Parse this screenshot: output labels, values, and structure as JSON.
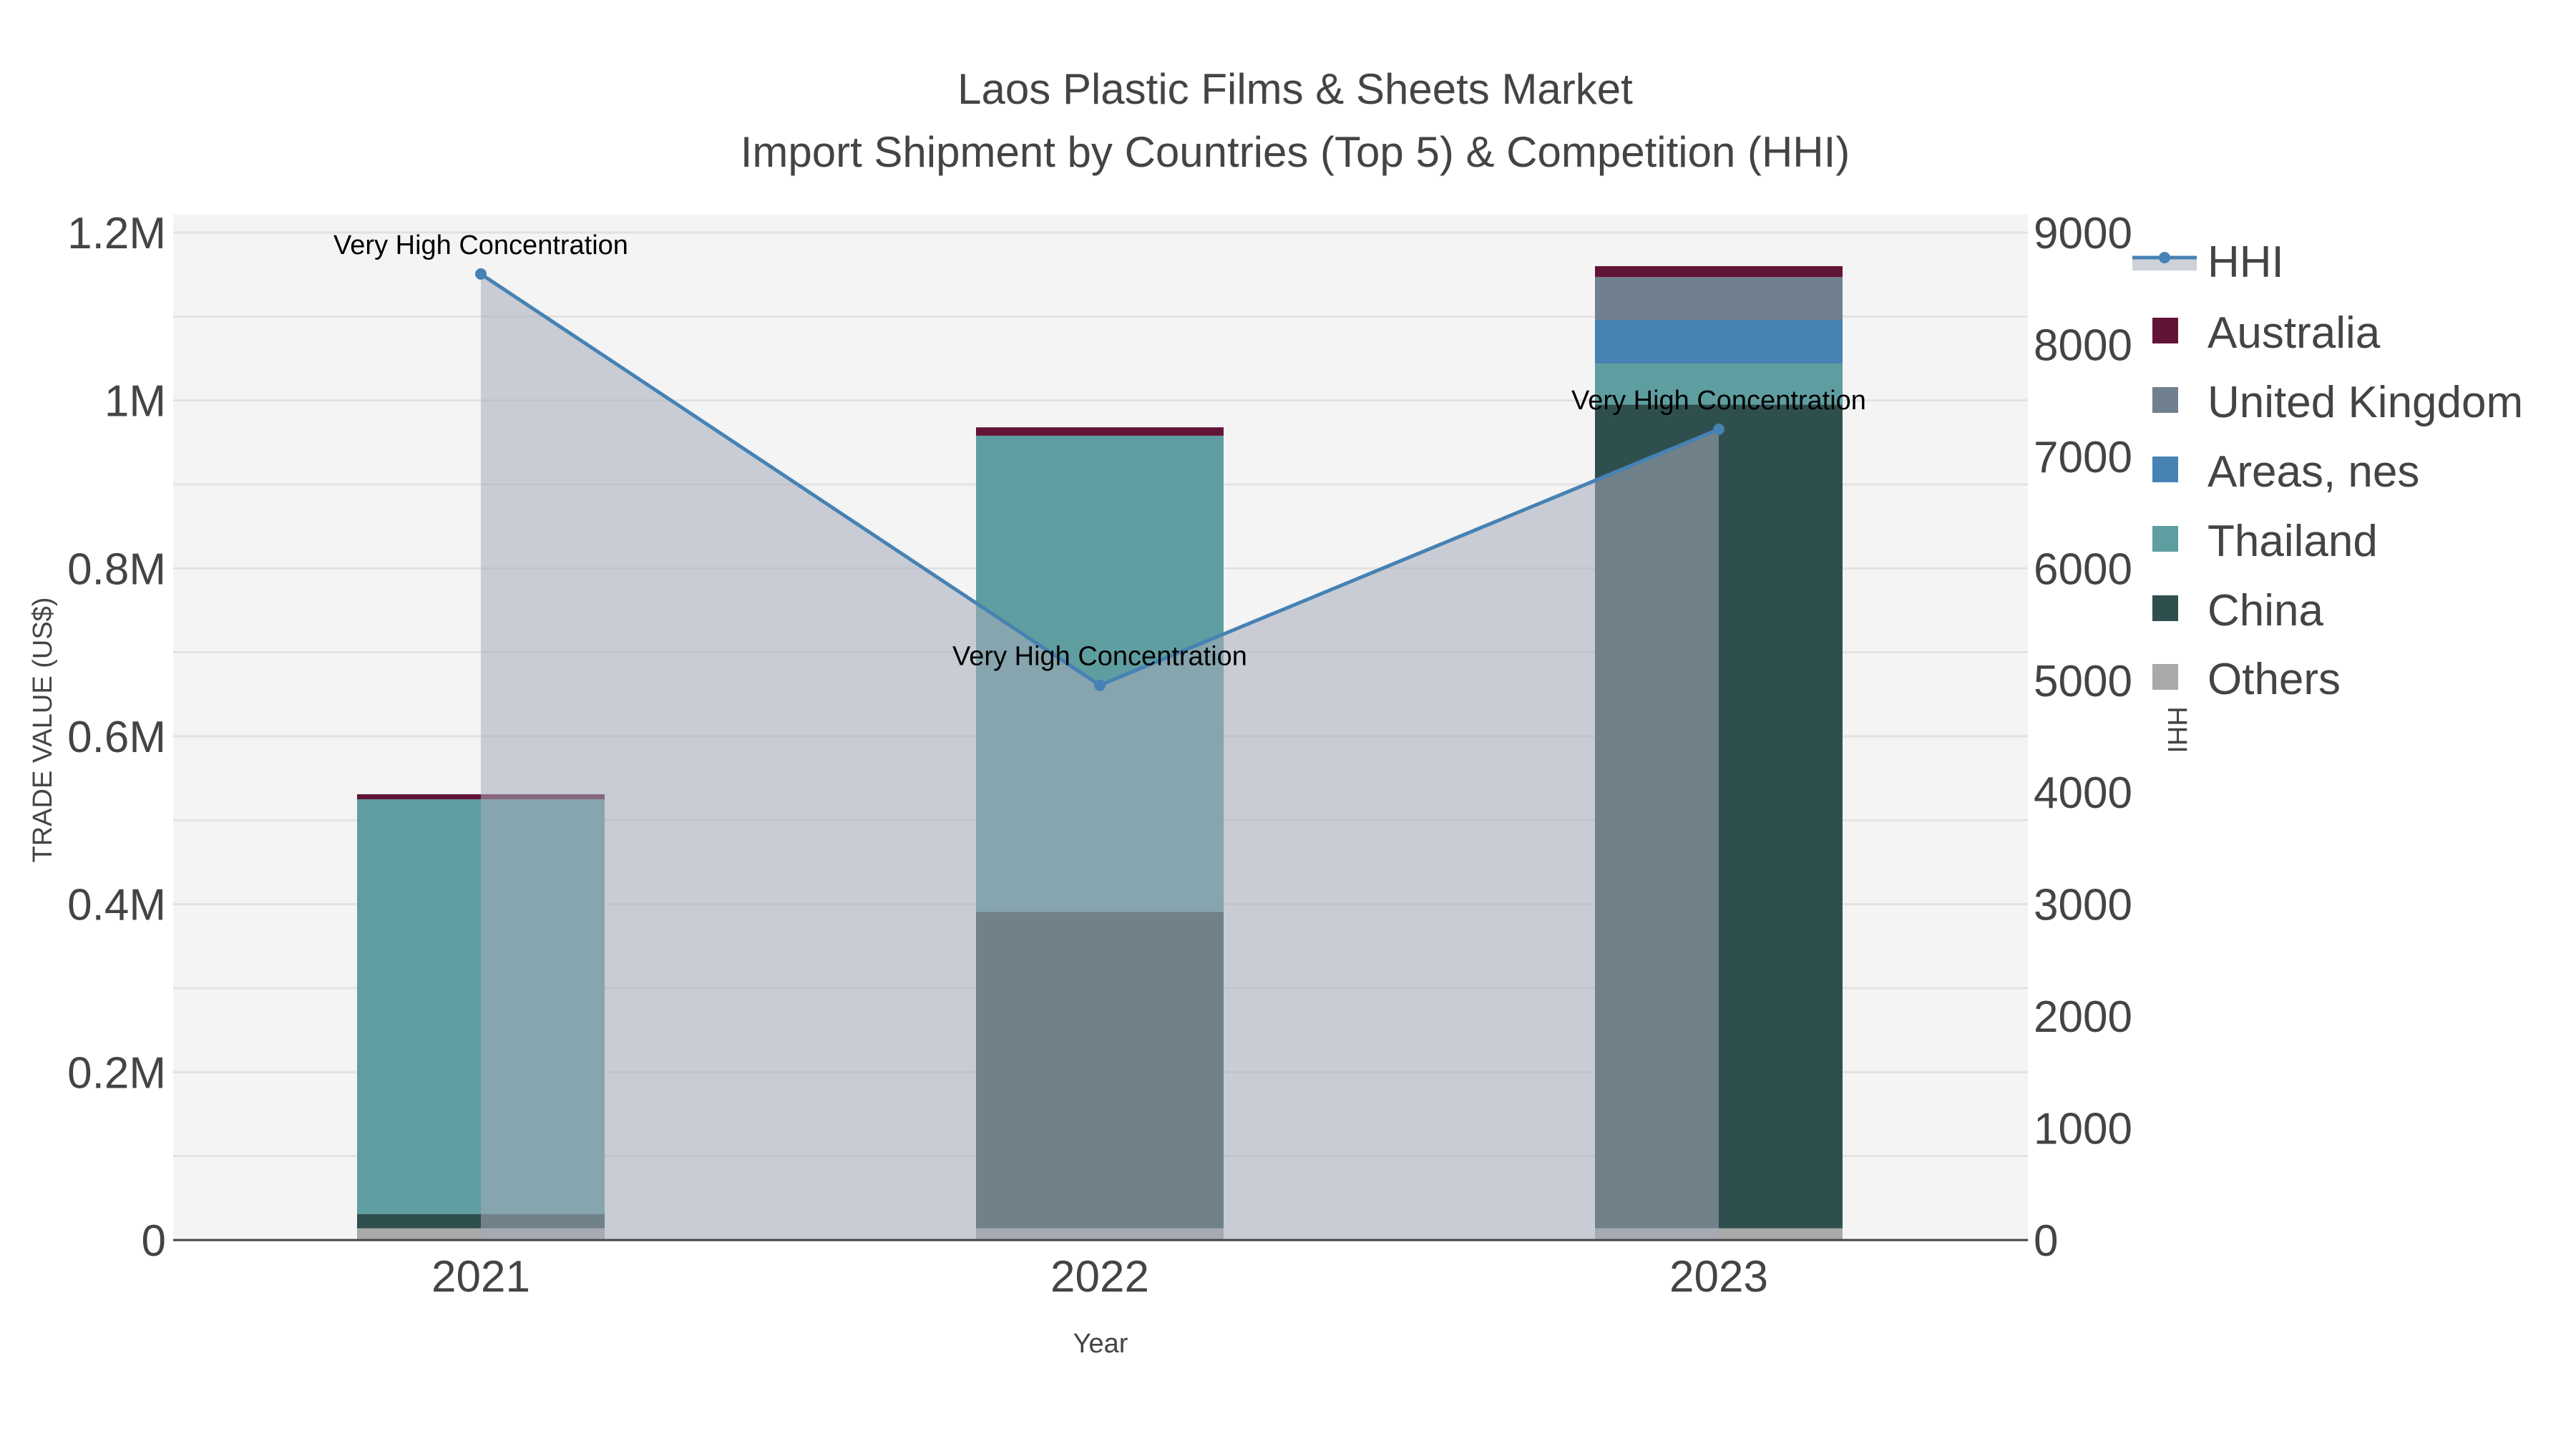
{
  "chart_data": {
    "type": "bar",
    "barmode": "stack",
    "title": "Laos Plastic Films & Sheets Market",
    "subtitle": "Import Shipment by Countries (Top 5) & Competition (HHI)",
    "xlabel": "Year",
    "ylabel": "TRADE VALUE (US$)",
    "y2label": "HHI",
    "categories": [
      "2021",
      "2022",
      "2023"
    ],
    "ylim": [
      0,
      1200000
    ],
    "y2lim": [
      0,
      9000
    ],
    "yticks": [
      {
        "v": 0,
        "label": "0"
      },
      {
        "v": 200000,
        "label": "0.2M"
      },
      {
        "v": 400000,
        "label": "0.4M"
      },
      {
        "v": 600000,
        "label": "0.6M"
      },
      {
        "v": 800000,
        "label": "0.8M"
      },
      {
        "v": 1000000,
        "label": "1M"
      },
      {
        "v": 1200000,
        "label": "1.2M"
      }
    ],
    "y2ticks": [
      "0",
      "1000",
      "2000",
      "3000",
      "4000",
      "5000",
      "6000",
      "7000",
      "8000",
      "9000"
    ],
    "series": [
      {
        "name": "Others",
        "color": "#a9a9a9",
        "values": [
          14000,
          14000,
          14000
        ]
      },
      {
        "name": "China",
        "color": "#2f4f4f",
        "values": [
          17000,
          377000,
          981000
        ]
      },
      {
        "name": "Thailand",
        "color": "#5f9ea0",
        "values": [
          494000,
          567000,
          49000
        ]
      },
      {
        "name": "Areas, nes",
        "color": "#4682b4",
        "values": [
          0,
          0,
          52000
        ]
      },
      {
        "name": "United Kingdom",
        "color": "#708090",
        "values": [
          0,
          0,
          51000
        ]
      },
      {
        "name": "Australia",
        "color": "#621437",
        "values": [
          6000,
          10000,
          13000
        ]
      }
    ],
    "hhi": {
      "name": "HHI",
      "color": "#4682b4",
      "values": [
        8630,
        4956,
        7242
      ],
      "annotations": [
        "Very High Concentration",
        "Very High Concentration",
        "Very High Concentration"
      ]
    },
    "legend_order": [
      "HHI",
      "Australia",
      "United Kingdom",
      "Areas, nes",
      "Thailand",
      "China",
      "Others"
    ],
    "legend_position": "right",
    "grid": true
  }
}
